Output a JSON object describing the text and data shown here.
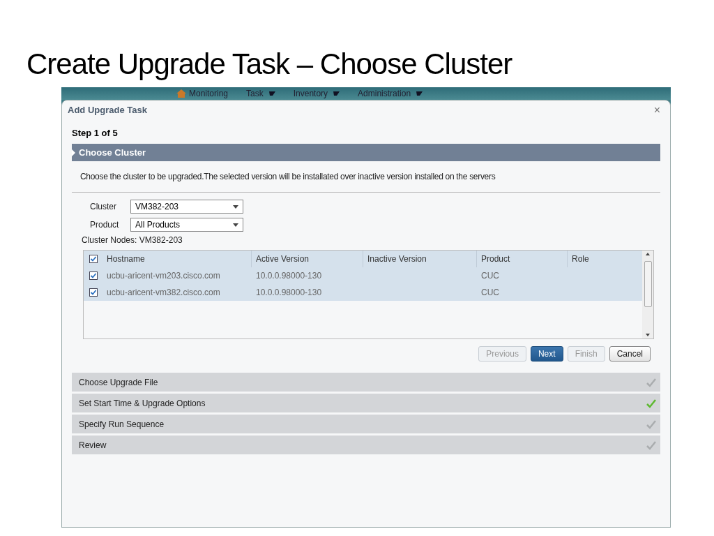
{
  "slide_title": "Create Upgrade Task – Choose Cluster",
  "nav": [
    {
      "label": "Monitoring",
      "kind": "home",
      "dropdown": false
    },
    {
      "label": "Task",
      "kind": "menu",
      "dropdown": true
    },
    {
      "label": "Inventory",
      "kind": "menu",
      "dropdown": true
    },
    {
      "label": "Administration",
      "kind": "menu",
      "dropdown": true
    }
  ],
  "dialog": {
    "title": "Add Upgrade Task",
    "close": "×",
    "step_label": "Step 1 of 5",
    "current_step": "Choose Cluster",
    "description": "Choose the cluster to be upgraded.The selected version will be installated over inactive version installed on the servers",
    "fields": [
      {
        "label": "Cluster",
        "value": "VM382-203"
      },
      {
        "label": "Product",
        "value": "All Products"
      }
    ],
    "nodes_label": "Cluster Nodes: VM382-203",
    "table": {
      "all_checked": true,
      "columns": [
        "Hostname",
        "Active Version",
        "Inactive Version",
        "Product",
        "Role"
      ],
      "rows": [
        {
          "checked": true,
          "cells": [
            "ucbu-aricent-vm203.cisco.com",
            "10.0.0.98000-130",
            "",
            "CUC",
            ""
          ]
        },
        {
          "checked": true,
          "cells": [
            "ucbu-aricent-vm382.cisco.com",
            "10.0.0.98000-130",
            "",
            "CUC",
            ""
          ]
        }
      ]
    },
    "buttons": [
      {
        "label": "Previous",
        "kind": "disabled"
      },
      {
        "label": "Next",
        "kind": "primary"
      },
      {
        "label": "Finish",
        "kind": "disabled"
      },
      {
        "label": "Cancel",
        "kind": "normal"
      }
    ],
    "steps": [
      {
        "label": "Choose Upgrade File",
        "done": false
      },
      {
        "label": "Set Start Time & Upgrade Options",
        "done": true
      },
      {
        "label": "Specify Run Sequence",
        "done": false
      },
      {
        "label": "Review",
        "done": false
      }
    ]
  }
}
